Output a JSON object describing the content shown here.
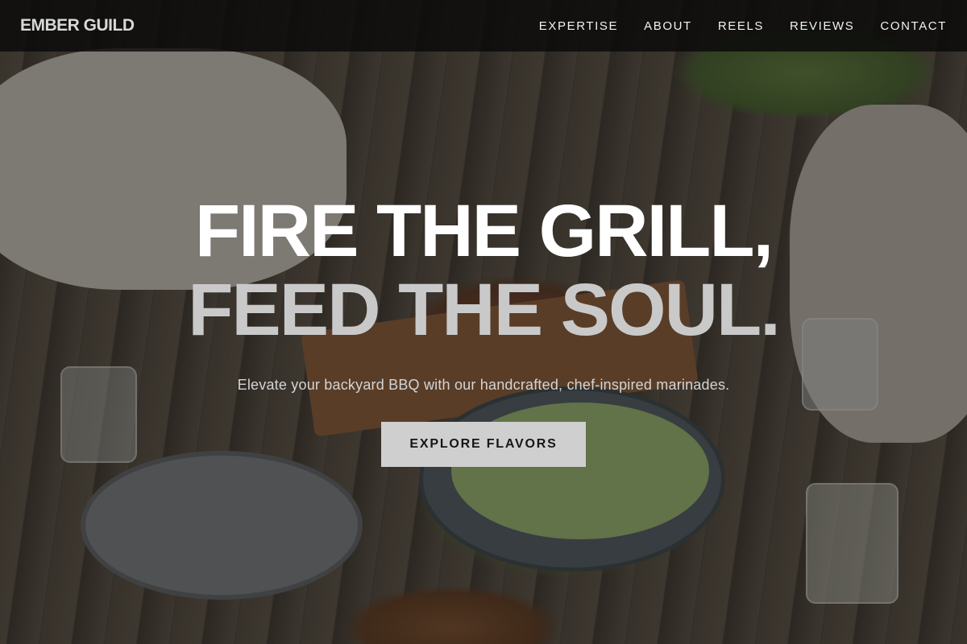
{
  "brand": {
    "logo_text": "EMBER GUILD"
  },
  "nav": {
    "items": [
      {
        "label": "EXPERTISE"
      },
      {
        "label": "ABOUT"
      },
      {
        "label": "REELS"
      },
      {
        "label": "REVIEWS"
      },
      {
        "label": "CONTACT"
      }
    ]
  },
  "hero": {
    "headline_line1": "FIRE THE GRILL,",
    "headline_line2": "FEED THE SOUL.",
    "subtitle": "Elevate your backyard BBQ with our handcrafted, chef-inspired marinades.",
    "cta_label": "EXPLORE FLAVORS"
  },
  "colors": {
    "navbar_bg": "#0a0a0a",
    "headline_primary": "#ffffff",
    "headline_secondary": "#c9c9c9",
    "cta_bg": "#cfcfcf",
    "cta_text": "#161616"
  }
}
